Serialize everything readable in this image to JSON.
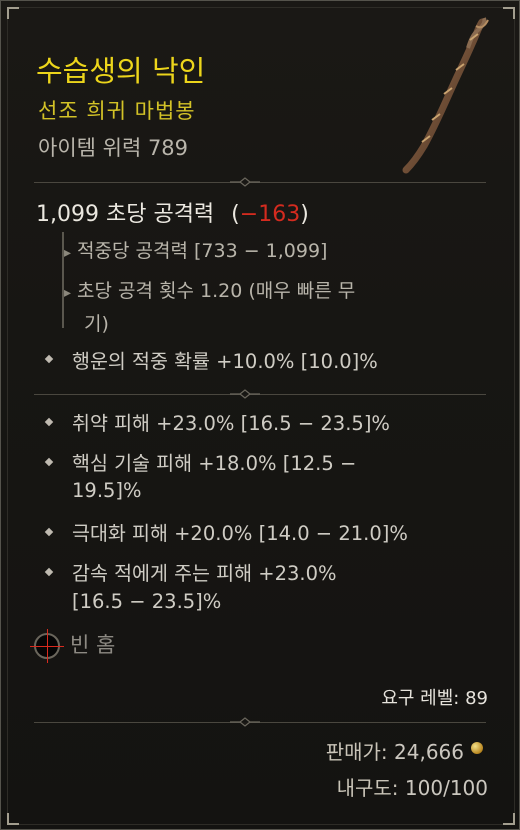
{
  "item": {
    "name": "수습생의 낙인",
    "type": "선조 희귀 마법봉",
    "power": "아이템 위력 789"
  },
  "damage": {
    "dps_value": "1,099 초당 공격력",
    "dps_paren_open": "(",
    "dps_diff": "−163",
    "dps_paren_close": ")",
    "per_hit": "적중당 공격력 [733 − 1,099]",
    "speed_line1": "초당 공격 횟수 1.20 (매우 빠른 무",
    "speed_line2": "기)"
  },
  "implicit": {
    "lucky_hit": "행운의 적중 확률 +10.0% [10.0]%"
  },
  "affixes": [
    {
      "line1": "취약 피해 +23.0% [16.5 − 23.5]%",
      "line2": ""
    },
    {
      "line1": "핵심 기술 피해 +18.0% [12.5 −",
      "line2": "19.5]%"
    },
    {
      "line1": "극대화 피해 +20.0% [14.0 − 21.0]%",
      "line2": ""
    },
    {
      "line1": "감속 적에게 주는 피해 +23.0%",
      "line2": "[16.5 − 23.5]%"
    }
  ],
  "socket": {
    "label": "빈 홈"
  },
  "footer": {
    "required_level": "요구 레벨: 89",
    "sell_label": "판매가:",
    "sell_value": "24,666",
    "durability_label": "내구도:",
    "durability_value": "100/100"
  },
  "colors": {
    "rare_yellow": "#ecd51b",
    "negative_red": "#d42b1f"
  },
  "icons": [
    "wand-image",
    "arrow-right-icon",
    "diamond-bullet-icon",
    "empty-socket-icon",
    "gold-coin-icon"
  ]
}
